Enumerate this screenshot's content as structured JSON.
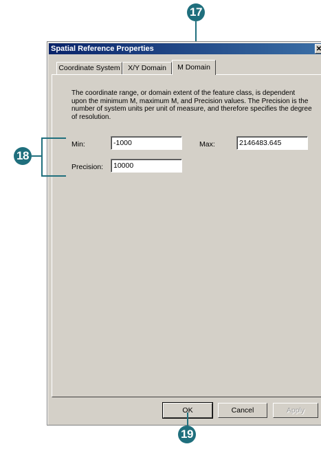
{
  "callouts": {
    "c17": "17",
    "c18": "18",
    "c19": "19"
  },
  "dialog": {
    "title": "Spatial Reference Properties",
    "close_glyph": "✕"
  },
  "tabs": [
    {
      "label": "Coordinate System"
    },
    {
      "label": "X/Y Domain"
    },
    {
      "label": "M Domain",
      "active": true
    }
  ],
  "description": "The coordinate range, or domain extent of the feature class, is dependent upon the minimum M, maximum M, and Precision values. The Precision is the number of system units per unit of measure, and therefore specifies the degree of resolution.",
  "fields": {
    "min_label": "Min:",
    "min_value": "-1000",
    "max_label": "Max:",
    "max_value": "2146483.645",
    "precision_label": "Precision:",
    "precision_value": "10000"
  },
  "buttons": {
    "ok": "OK",
    "cancel": "Cancel",
    "apply": "Apply"
  },
  "colors": {
    "callout": "#1f6f7d",
    "titlebar_start": "#0a246a",
    "titlebar_end": "#3a6ea5",
    "face": "#d4d0c8"
  }
}
